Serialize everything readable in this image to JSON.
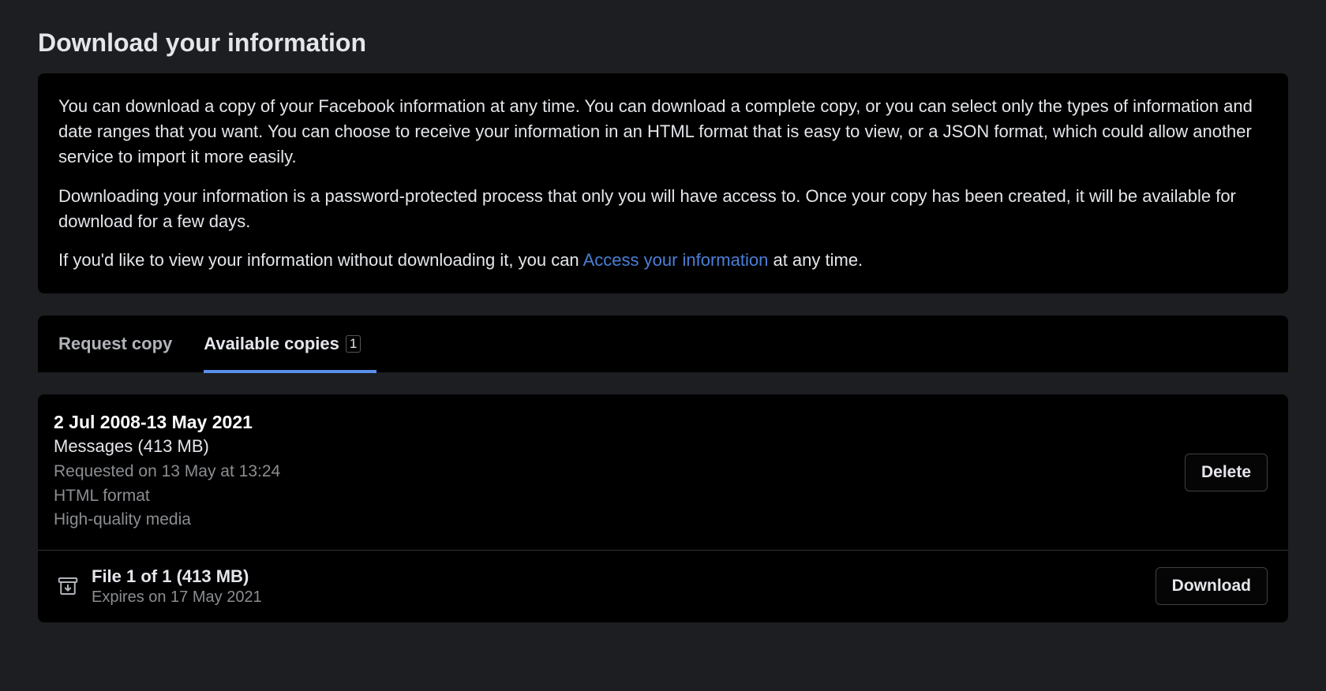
{
  "pageTitle": "Download your information",
  "info": {
    "p1": "You can download a copy of your Facebook information at any time. You can download a complete copy, or you can select only the types of information and date ranges that you want. You can choose to receive your information in an HTML format that is easy to view, or a JSON format, which could allow another service to import it more easily.",
    "p2": "Downloading your information is a password-protected process that only you will have access to. Once your copy has been created, it will be available for download for a few days.",
    "p3_prefix": "If you'd like to view your information without downloading it, you can ",
    "p3_link": "Access your information",
    "p3_suffix": " at any time."
  },
  "tabs": {
    "request": "Request copy",
    "available": "Available copies",
    "availableCount": "1"
  },
  "copy": {
    "dateRange": "2 Jul 2008-13 May 2021",
    "contentSize": "Messages (413 MB)",
    "requested": "Requested on 13 May at 13:24",
    "format": "HTML format",
    "mediaQuality": "High-quality media",
    "deleteLabel": "Delete"
  },
  "file": {
    "label": "File 1 of 1 (413 MB)",
    "expiry": "Expires on 17 May 2021",
    "downloadLabel": "Download"
  }
}
